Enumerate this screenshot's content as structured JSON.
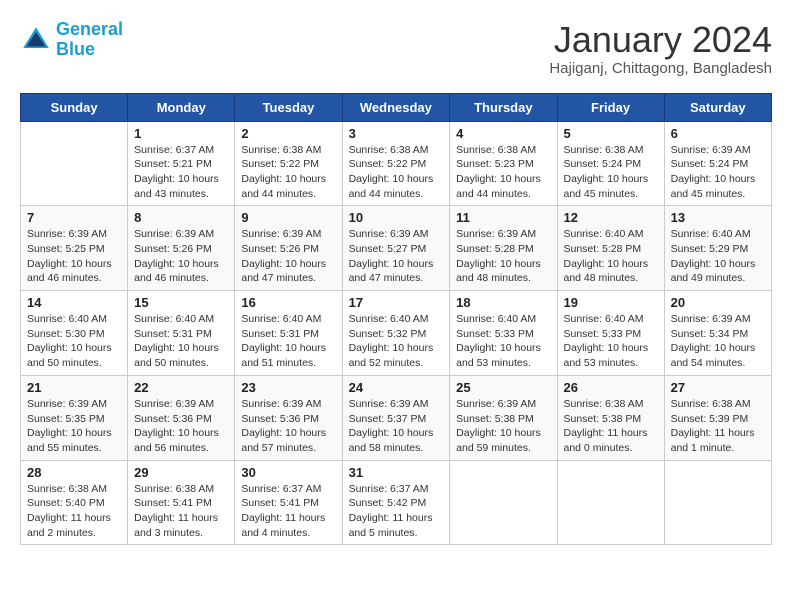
{
  "header": {
    "logo_line1": "General",
    "logo_line2": "Blue",
    "title": "January 2024",
    "location": "Hajiganj, Chittagong, Bangladesh"
  },
  "days_of_week": [
    "Sunday",
    "Monday",
    "Tuesday",
    "Wednesday",
    "Thursday",
    "Friday",
    "Saturday"
  ],
  "weeks": [
    [
      {
        "day": null
      },
      {
        "day": 1,
        "sunrise": "6:37 AM",
        "sunset": "5:21 PM",
        "daylight": "10 hours and 43 minutes."
      },
      {
        "day": 2,
        "sunrise": "6:38 AM",
        "sunset": "5:22 PM",
        "daylight": "10 hours and 44 minutes."
      },
      {
        "day": 3,
        "sunrise": "6:38 AM",
        "sunset": "5:22 PM",
        "daylight": "10 hours and 44 minutes."
      },
      {
        "day": 4,
        "sunrise": "6:38 AM",
        "sunset": "5:23 PM",
        "daylight": "10 hours and 44 minutes."
      },
      {
        "day": 5,
        "sunrise": "6:38 AM",
        "sunset": "5:24 PM",
        "daylight": "10 hours and 45 minutes."
      },
      {
        "day": 6,
        "sunrise": "6:39 AM",
        "sunset": "5:24 PM",
        "daylight": "10 hours and 45 minutes."
      }
    ],
    [
      {
        "day": 7,
        "sunrise": "6:39 AM",
        "sunset": "5:25 PM",
        "daylight": "10 hours and 46 minutes."
      },
      {
        "day": 8,
        "sunrise": "6:39 AM",
        "sunset": "5:26 PM",
        "daylight": "10 hours and 46 minutes."
      },
      {
        "day": 9,
        "sunrise": "6:39 AM",
        "sunset": "5:26 PM",
        "daylight": "10 hours and 47 minutes."
      },
      {
        "day": 10,
        "sunrise": "6:39 AM",
        "sunset": "5:27 PM",
        "daylight": "10 hours and 47 minutes."
      },
      {
        "day": 11,
        "sunrise": "6:39 AM",
        "sunset": "5:28 PM",
        "daylight": "10 hours and 48 minutes."
      },
      {
        "day": 12,
        "sunrise": "6:40 AM",
        "sunset": "5:28 PM",
        "daylight": "10 hours and 48 minutes."
      },
      {
        "day": 13,
        "sunrise": "6:40 AM",
        "sunset": "5:29 PM",
        "daylight": "10 hours and 49 minutes."
      }
    ],
    [
      {
        "day": 14,
        "sunrise": "6:40 AM",
        "sunset": "5:30 PM",
        "daylight": "10 hours and 50 minutes."
      },
      {
        "day": 15,
        "sunrise": "6:40 AM",
        "sunset": "5:31 PM",
        "daylight": "10 hours and 50 minutes."
      },
      {
        "day": 16,
        "sunrise": "6:40 AM",
        "sunset": "5:31 PM",
        "daylight": "10 hours and 51 minutes."
      },
      {
        "day": 17,
        "sunrise": "6:40 AM",
        "sunset": "5:32 PM",
        "daylight": "10 hours and 52 minutes."
      },
      {
        "day": 18,
        "sunrise": "6:40 AM",
        "sunset": "5:33 PM",
        "daylight": "10 hours and 53 minutes."
      },
      {
        "day": 19,
        "sunrise": "6:40 AM",
        "sunset": "5:33 PM",
        "daylight": "10 hours and 53 minutes."
      },
      {
        "day": 20,
        "sunrise": "6:39 AM",
        "sunset": "5:34 PM",
        "daylight": "10 hours and 54 minutes."
      }
    ],
    [
      {
        "day": 21,
        "sunrise": "6:39 AM",
        "sunset": "5:35 PM",
        "daylight": "10 hours and 55 minutes."
      },
      {
        "day": 22,
        "sunrise": "6:39 AM",
        "sunset": "5:36 PM",
        "daylight": "10 hours and 56 minutes."
      },
      {
        "day": 23,
        "sunrise": "6:39 AM",
        "sunset": "5:36 PM",
        "daylight": "10 hours and 57 minutes."
      },
      {
        "day": 24,
        "sunrise": "6:39 AM",
        "sunset": "5:37 PM",
        "daylight": "10 hours and 58 minutes."
      },
      {
        "day": 25,
        "sunrise": "6:39 AM",
        "sunset": "5:38 PM",
        "daylight": "10 hours and 59 minutes."
      },
      {
        "day": 26,
        "sunrise": "6:38 AM",
        "sunset": "5:38 PM",
        "daylight": "11 hours and 0 minutes."
      },
      {
        "day": 27,
        "sunrise": "6:38 AM",
        "sunset": "5:39 PM",
        "daylight": "11 hours and 1 minute."
      }
    ],
    [
      {
        "day": 28,
        "sunrise": "6:38 AM",
        "sunset": "5:40 PM",
        "daylight": "11 hours and 2 minutes."
      },
      {
        "day": 29,
        "sunrise": "6:38 AM",
        "sunset": "5:41 PM",
        "daylight": "11 hours and 3 minutes."
      },
      {
        "day": 30,
        "sunrise": "6:37 AM",
        "sunset": "5:41 PM",
        "daylight": "11 hours and 4 minutes."
      },
      {
        "day": 31,
        "sunrise": "6:37 AM",
        "sunset": "5:42 PM",
        "daylight": "11 hours and 5 minutes."
      },
      {
        "day": null
      },
      {
        "day": null
      },
      {
        "day": null
      }
    ]
  ],
  "labels": {
    "sunrise": "Sunrise:",
    "sunset": "Sunset:",
    "daylight": "Daylight:"
  }
}
